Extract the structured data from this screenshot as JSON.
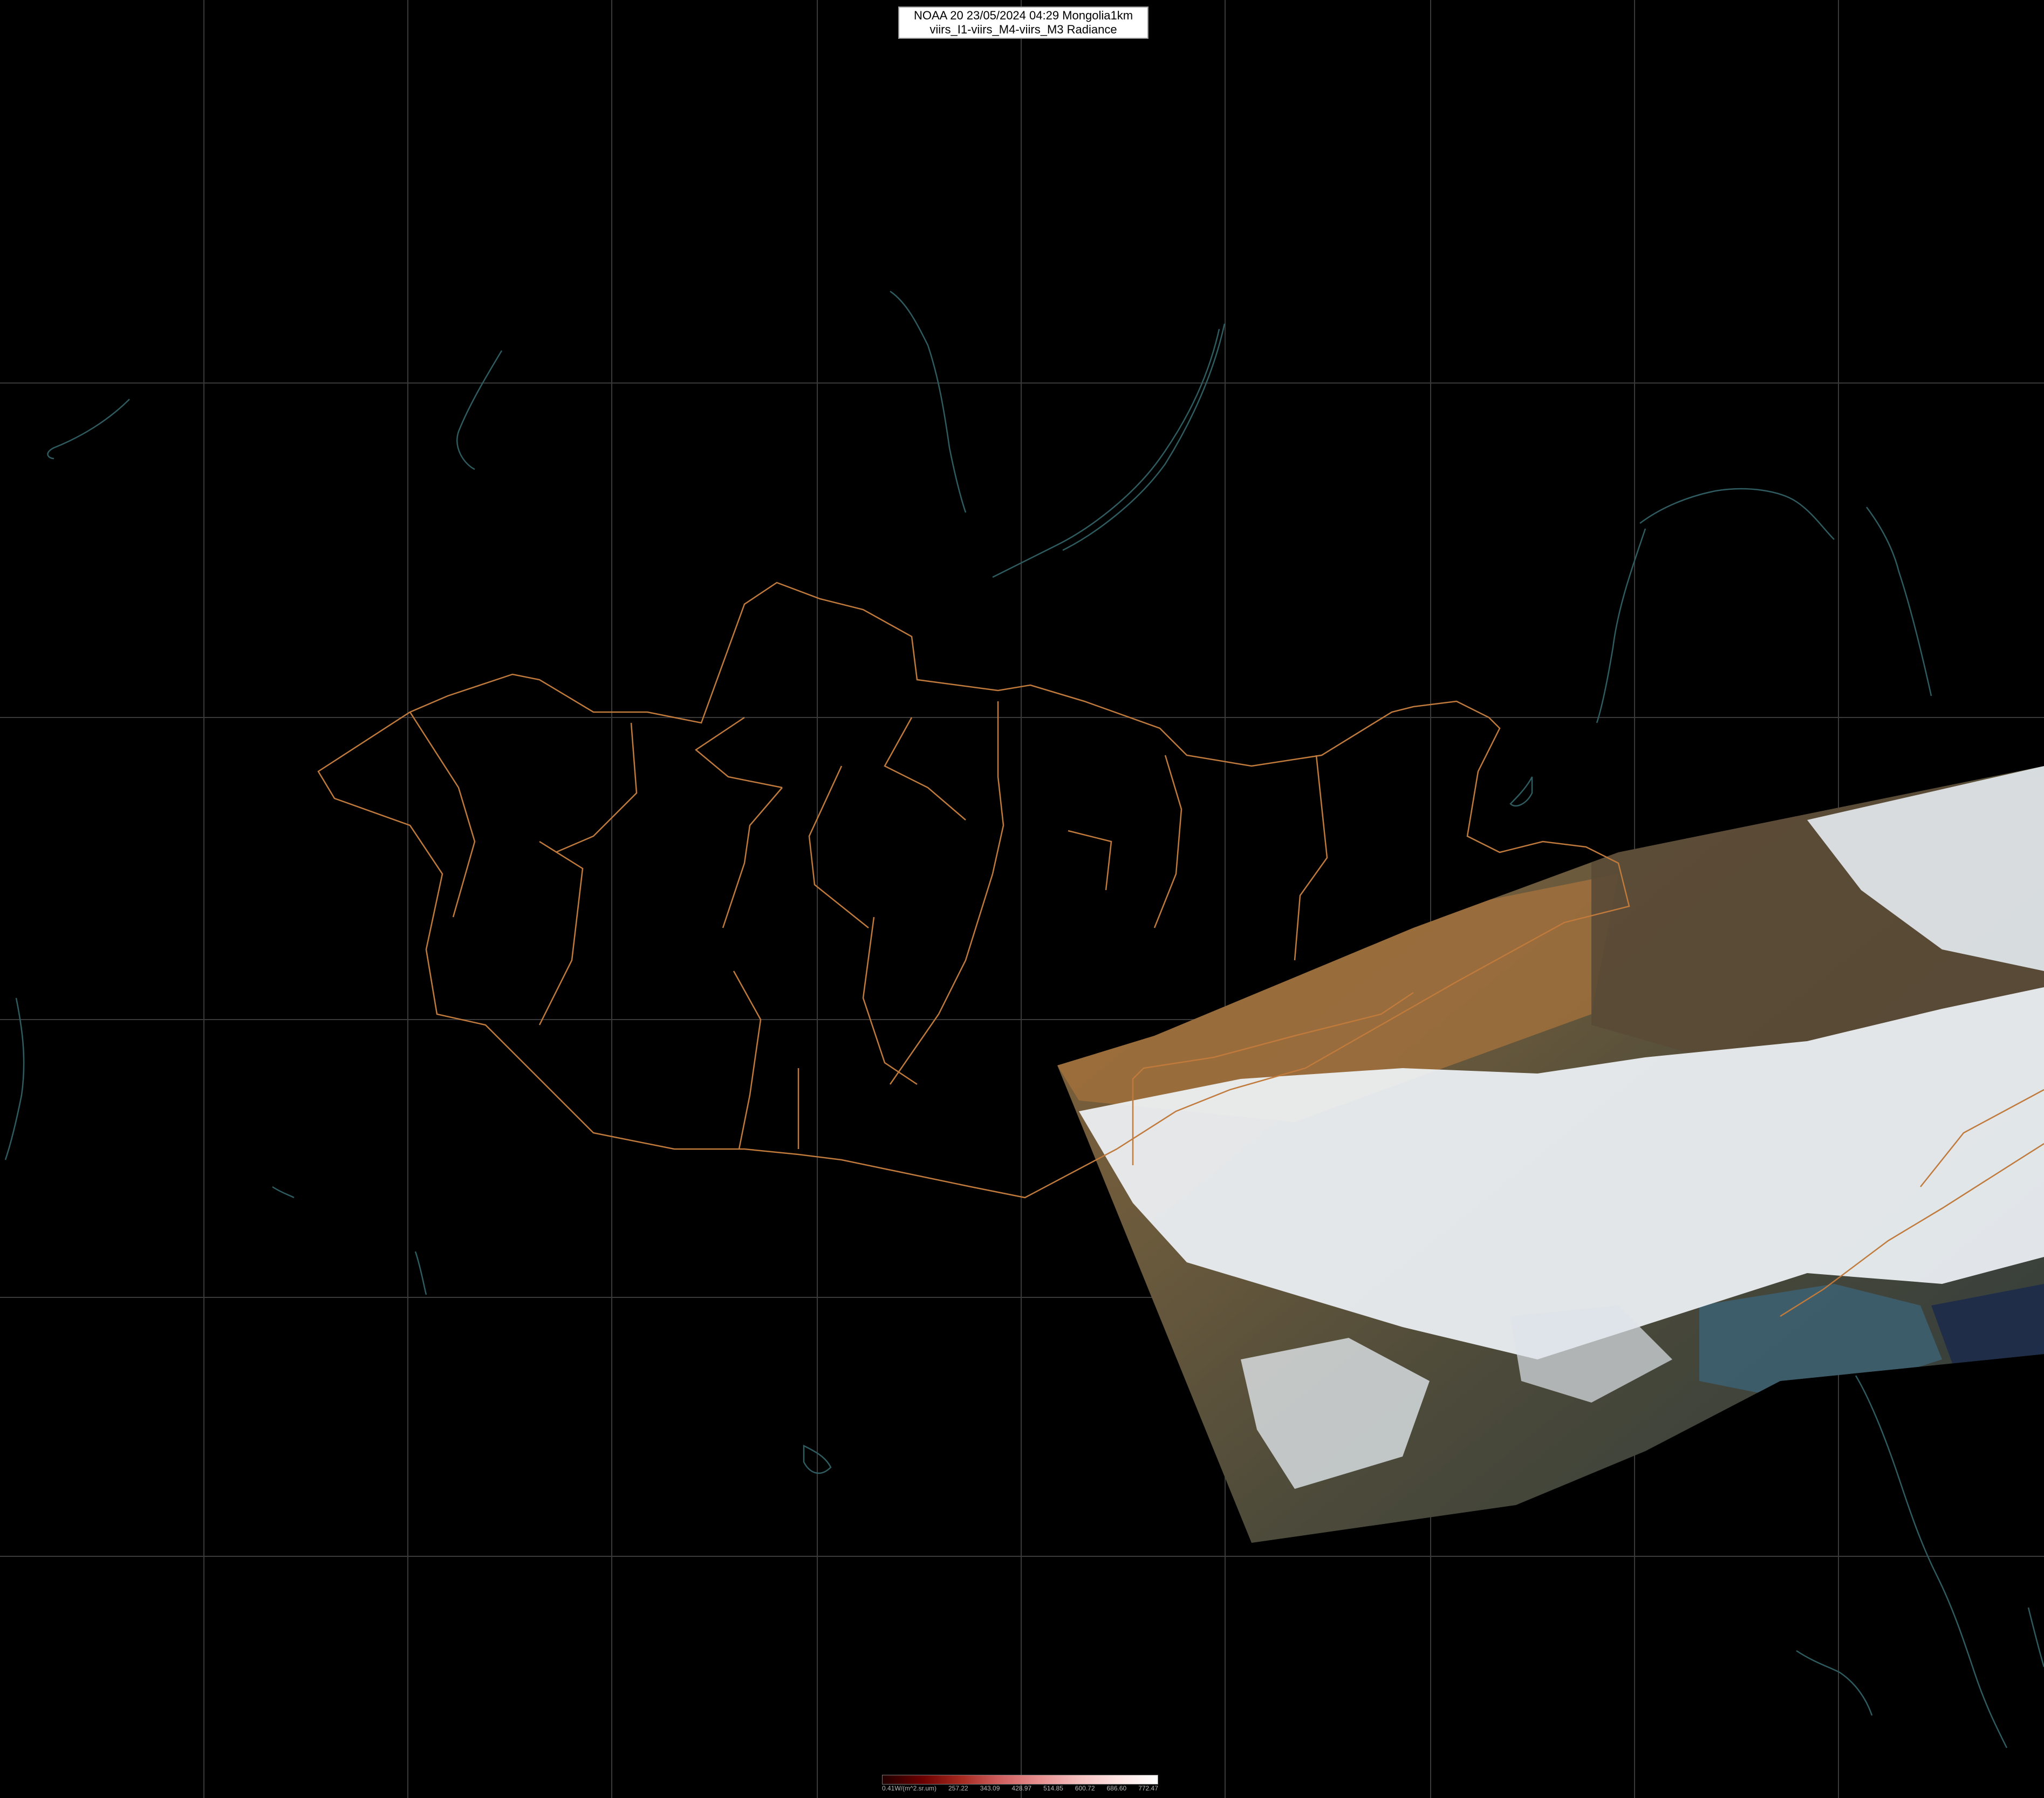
{
  "title": {
    "line1": "NOAA 20 23/05/2024 04:29 Mongolia1km",
    "line2": "viirs_I1-viirs_M4-viirs_M3 Radiance"
  },
  "colorbar": {
    "labels": [
      "0.41W/(m^2.sr.um)",
      "257.22",
      "343.09",
      "428.97",
      "514.85",
      "600.72",
      "686.60",
      "772.47"
    ],
    "colors": [
      "#200000",
      "#6a0000",
      "#a52a20",
      "#d06060",
      "#e89090",
      "#f6c0c0",
      "#ffe4e4",
      "#ffffff"
    ]
  },
  "colors": {
    "background": "#000000",
    "grid": "#3a3a3a",
    "admin_border": "#c07a3c",
    "coastline": "#2f5c60",
    "desert": "#9a6a3a",
    "land_green": "#4a5a3a",
    "cloud": "#eef2f6",
    "sea": "#3d5f70"
  }
}
